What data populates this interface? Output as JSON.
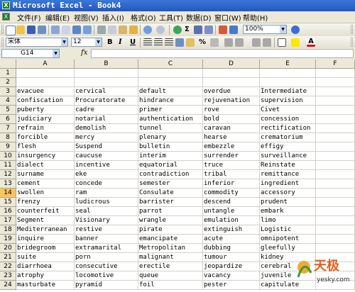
{
  "window": {
    "title": "Microsoft Excel - Book4"
  },
  "menu": [
    "文件(F)",
    "编辑(E)",
    "视图(V)",
    "插入(I)",
    "格式(O)",
    "工具(T)",
    "数据(D)",
    "窗口(W)",
    "帮助(H)"
  ],
  "toolbar": {
    "zoom": "100%",
    "sum_symbol": "Σ"
  },
  "format": {
    "font": "宋体",
    "size": "12",
    "bold": "B",
    "italic": "I",
    "underline": "U",
    "percent": "%"
  },
  "formula": {
    "cell": "G14",
    "fx": "fx",
    "value": ""
  },
  "columns": [
    "A",
    "B",
    "C",
    "D",
    "E",
    "F"
  ],
  "rows": [
    "1",
    "2",
    "3",
    "4",
    "5",
    "6",
    "7",
    "8",
    "9",
    "10",
    "11",
    "12",
    "13",
    "14",
    "15",
    "16",
    "17",
    "18",
    "19",
    "20",
    "21",
    "22",
    "23",
    "24"
  ],
  "selected_row": "14",
  "sheet": {
    "r3": [
      "evacuee",
      "cervical",
      "default",
      "overdue",
      "Intermediate"
    ],
    "r4": [
      "confiscation",
      "Procuratorate",
      "hindrance",
      "rejuvenation",
      "supervision"
    ],
    "r5": [
      "puberty",
      "cadre",
      "primer",
      "rove",
      "Civet"
    ],
    "r6": [
      "judiciary",
      "notarial",
      "authentication",
      "bold",
      "concession"
    ],
    "r7": [
      "refrain",
      "demolish",
      "tunnel",
      "caravan",
      "rectification"
    ],
    "r8": [
      "forcible",
      "mercy",
      "plenary",
      "hearse",
      "crematorium"
    ],
    "r9": [
      "flesh",
      "Suspend",
      "bulletin",
      "embezzle",
      "effigy"
    ],
    "r10": [
      "insurgency",
      "caucuse",
      "interim",
      "surrender",
      "surveillance"
    ],
    "r11": [
      "dialect",
      "incentive",
      "equatorial",
      "truce",
      "Reinstate"
    ],
    "r12": [
      "surname",
      "eke",
      "contradiction",
      "tribal",
      "remittance"
    ],
    "r13": [
      "cement",
      "concede",
      "semester",
      "inferior",
      "ingredient"
    ],
    "r14": [
      "swollen",
      "ram",
      "Consulate",
      "commodity",
      "accessory"
    ],
    "r15": [
      "frenzy",
      "ludicrous",
      "barrister",
      "descend",
      "prudent"
    ],
    "r16": [
      "counterfeit",
      "seal",
      "parrot",
      "untangle",
      "embark"
    ],
    "r17": [
      "Segment",
      "Visionary",
      "wrangle",
      "emulation",
      "limo"
    ],
    "r18": [
      "Mediterranean",
      "restive",
      "pirate",
      "extinguish",
      "Logistic"
    ],
    "r19": [
      "inquire",
      "banner",
      "emancipate",
      "acute",
      "omnipotent"
    ],
    "r20": [
      "bridegroom",
      "extramarital",
      "Metropolitan",
      "dubbing",
      "gleefully"
    ],
    "r21": [
      "suite",
      "porn",
      "malignant",
      "tumour",
      "kidney"
    ],
    "r22": [
      "diarrhoea",
      "consecutive",
      "erectile",
      "jeopardize",
      "cerebral"
    ],
    "r23": [
      "atrophy",
      "locomotive",
      "queue",
      "vacancy",
      "juvenile"
    ],
    "r24": [
      "masturbate",
      "pyramid",
      "foil",
      "pester",
      "capitulate"
    ]
  },
  "watermark": {
    "brand": "天极",
    "site": "yesky.com"
  },
  "colors": {
    "title_bar": "#2f63c8",
    "chrome": "#ece9d8",
    "row_highlight": "#ffc45a",
    "font_color": "#e0001a"
  }
}
